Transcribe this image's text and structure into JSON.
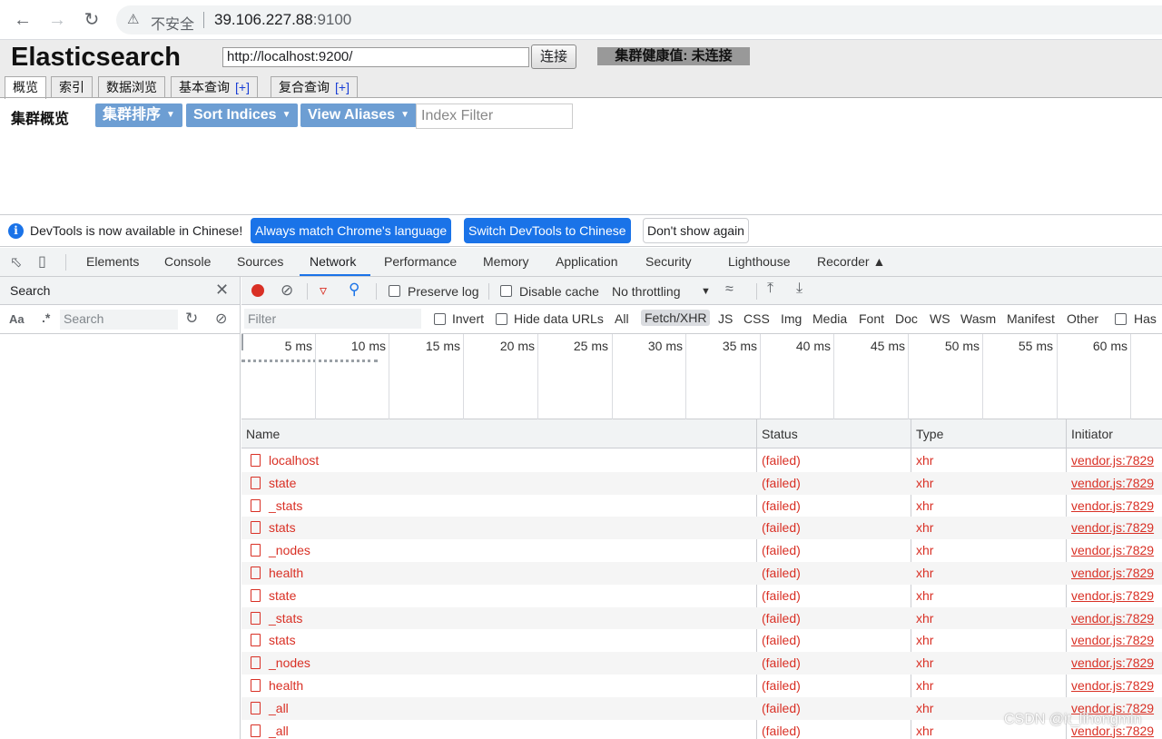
{
  "browser": {
    "insecure_label": "不安全",
    "url_host": "39.106.227.88",
    "url_port": ":9100"
  },
  "es": {
    "title": "Elasticsearch",
    "connect_url": "http://localhost:9200/",
    "connect_label": "连接",
    "health": "集群健康值: 未连接",
    "tabs": [
      {
        "label": "概览",
        "plus": ""
      },
      {
        "label": "索引",
        "plus": ""
      },
      {
        "label": "数据浏览",
        "plus": ""
      },
      {
        "label": "基本查询",
        "plus": "[+]"
      },
      {
        "label": "复合查询",
        "plus": "[+]"
      }
    ],
    "sub_title": "集群概览",
    "sort_cluster": "集群排序",
    "sort_indices": "Sort Indices",
    "view_aliases": "View Aliases",
    "index_filter_placeholder": "Index Filter"
  },
  "devtools": {
    "infobar": {
      "message": "DevTools is now available in Chinese!",
      "btn_match": "Always match Chrome's language",
      "btn_switch": "Switch DevTools to Chinese",
      "btn_dismiss": "Don't show again"
    },
    "tabs": [
      "Elements",
      "Console",
      "Sources",
      "Network",
      "Performance",
      "Memory",
      "Application",
      "Security",
      "Lighthouse",
      "Recorder"
    ],
    "search_panel": {
      "title": "Search",
      "case_label": "Aa",
      "regex_label": ".*",
      "placeholder": "Search"
    },
    "network": {
      "preserve_log": "Preserve log",
      "disable_cache": "Disable cache",
      "throttling": "No throttling",
      "filter_placeholder": "Filter",
      "invert": "Invert",
      "hide_data_urls": "Hide data URLs",
      "types": [
        "All",
        "Fetch/XHR",
        "JS",
        "CSS",
        "Img",
        "Media",
        "Font",
        "Doc",
        "WS",
        "Wasm",
        "Manifest",
        "Other"
      ],
      "selected_type": "Fetch/XHR",
      "has_label": "Has",
      "timeline_labels": [
        "5 ms",
        "10 ms",
        "15 ms",
        "20 ms",
        "25 ms",
        "30 ms",
        "35 ms",
        "40 ms",
        "45 ms",
        "50 ms",
        "55 ms",
        "60 ms"
      ],
      "columns": {
        "name": "Name",
        "status": "Status",
        "type": "Type",
        "initiator": "Initiator"
      },
      "rows": [
        {
          "name": "localhost",
          "status": "(failed)",
          "type": "xhr",
          "initiator": "vendor.js:7829"
        },
        {
          "name": "state",
          "status": "(failed)",
          "type": "xhr",
          "initiator": "vendor.js:7829"
        },
        {
          "name": "_stats",
          "status": "(failed)",
          "type": "xhr",
          "initiator": "vendor.js:7829"
        },
        {
          "name": "stats",
          "status": "(failed)",
          "type": "xhr",
          "initiator": "vendor.js:7829"
        },
        {
          "name": "_nodes",
          "status": "(failed)",
          "type": "xhr",
          "initiator": "vendor.js:7829"
        },
        {
          "name": "health",
          "status": "(failed)",
          "type": "xhr",
          "initiator": "vendor.js:7829"
        },
        {
          "name": "state",
          "status": "(failed)",
          "type": "xhr",
          "initiator": "vendor.js:7829"
        },
        {
          "name": "_stats",
          "status": "(failed)",
          "type": "xhr",
          "initiator": "vendor.js:7829"
        },
        {
          "name": "stats",
          "status": "(failed)",
          "type": "xhr",
          "initiator": "vendor.js:7829"
        },
        {
          "name": "_nodes",
          "status": "(failed)",
          "type": "xhr",
          "initiator": "vendor.js:7829"
        },
        {
          "name": "health",
          "status": "(failed)",
          "type": "xhr",
          "initiator": "vendor.js:7829"
        },
        {
          "name": "_all",
          "status": "(failed)",
          "type": "xhr",
          "initiator": "vendor.js:7829"
        },
        {
          "name": "_all",
          "status": "(failed)",
          "type": "xhr",
          "initiator": "vendor.js:7829"
        }
      ]
    }
  },
  "watermark": "CSDN @it_lihongmin",
  "colors": {
    "accent": "#1a73e8",
    "error": "#d93025",
    "es_button": "#6d9ed3"
  }
}
